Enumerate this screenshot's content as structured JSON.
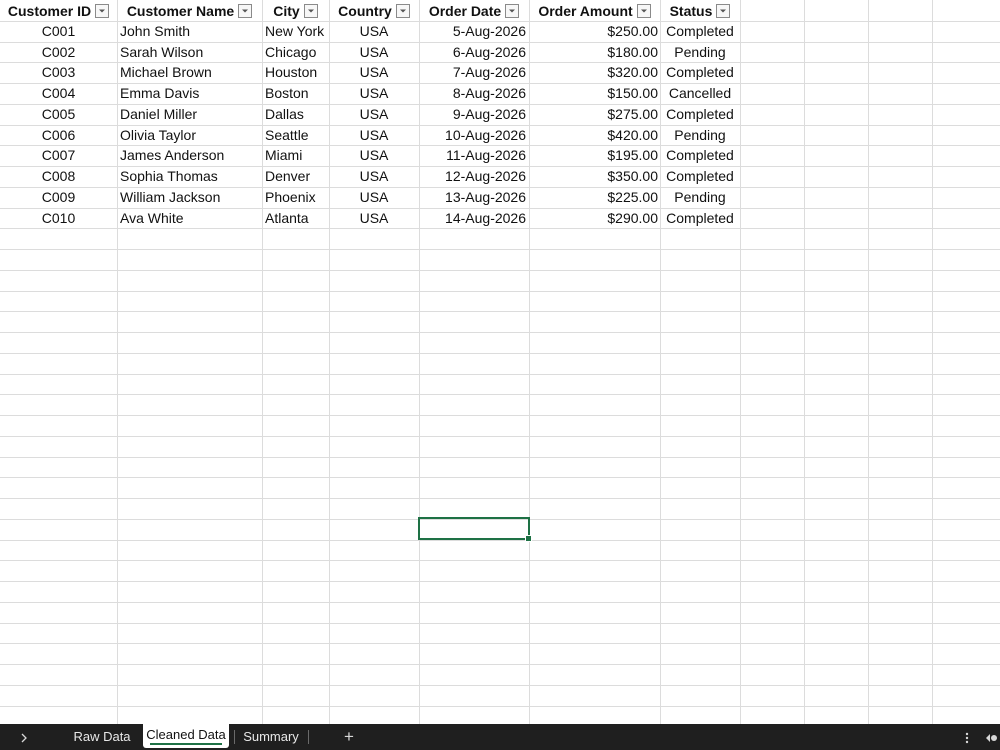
{
  "sheet": {
    "columns": [
      {
        "key": "customer_id",
        "header": "Customer ID"
      },
      {
        "key": "customer_name",
        "header": "Customer Name"
      },
      {
        "key": "city",
        "header": "City"
      },
      {
        "key": "country",
        "header": "Country"
      },
      {
        "key": "order_date",
        "header": "Order Date"
      },
      {
        "key": "order_amount",
        "header": "Order Amount"
      },
      {
        "key": "status",
        "header": "Status"
      }
    ],
    "rows": [
      [
        "C001",
        "John Smith",
        "New York",
        "USA",
        "5-Aug-2026",
        "$250.00",
        "Completed"
      ],
      [
        "C002",
        "Sarah Wilson",
        "Chicago",
        "USA",
        "6-Aug-2026",
        "$180.00",
        "Pending"
      ],
      [
        "C003",
        "Michael Brown",
        "Houston",
        "USA",
        "7-Aug-2026",
        "$320.00",
        "Completed"
      ],
      [
        "C004",
        "Emma Davis",
        "Boston",
        "USA",
        "8-Aug-2026",
        "$150.00",
        "Cancelled"
      ],
      [
        "C005",
        "Daniel Miller",
        "Dallas",
        "USA",
        "9-Aug-2026",
        "$275.00",
        "Completed"
      ],
      [
        "C006",
        "Olivia Taylor",
        "Seattle",
        "USA",
        "10-Aug-2026",
        "$420.00",
        "Pending"
      ],
      [
        "C007",
        "James Anderson",
        "Miami",
        "USA",
        "11-Aug-2026",
        "$195.00",
        "Completed"
      ],
      [
        "C008",
        "Sophia Thomas",
        "Denver",
        "USA",
        "12-Aug-2026",
        "$350.00",
        "Completed"
      ],
      [
        "C009",
        "William Jackson",
        "Phoenix",
        "USA",
        "13-Aug-2026",
        "$225.00",
        "Pending"
      ],
      [
        "C010",
        "Ava White",
        "Atlanta",
        "USA",
        "14-Aug-2026",
        "$290.00",
        "Completed"
      ]
    ]
  },
  "tabs": {
    "items": [
      {
        "label": "Raw Data",
        "active": false
      },
      {
        "label": "Cleaned Data",
        "active": true
      },
      {
        "label": "Summary",
        "active": false
      }
    ],
    "add_label": "+",
    "nav_prev_icon": "chevron-right-icon",
    "more_icon": "vertical-ellipsis-icon",
    "scroll_icon": "scroll-left-icon"
  },
  "colors": {
    "accent": "#1e7145",
    "tabbar_bg": "#1f1f1f",
    "gridline": "#dcdcdc"
  }
}
